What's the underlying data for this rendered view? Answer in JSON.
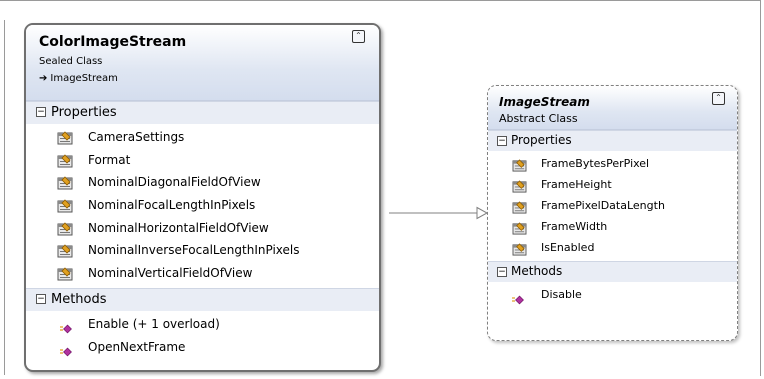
{
  "color_image_stream": {
    "title": "ColorImageStream",
    "kind": "Sealed Class",
    "base_arrow": "➔",
    "base": "ImageStream",
    "collapse_glyph": "⌃",
    "properties_label": "Properties",
    "properties": [
      "CameraSettings",
      "Format",
      "NominalDiagonalFieldOfView",
      "NominalFocalLengthInPixels",
      "NominalHorizontalFieldOfView",
      "NominalInverseFocalLengthInPixels",
      "NominalVerticalFieldOfView"
    ],
    "methods_label": "Methods",
    "methods": [
      "Enable (+ 1 overload)",
      "OpenNextFrame"
    ]
  },
  "image_stream": {
    "title": "ImageStream",
    "kind": "Abstract Class",
    "collapse_glyph": "⌃",
    "properties_label": "Properties",
    "properties": [
      "FrameBytesPerPixel",
      "FrameHeight",
      "FramePixelDataLength",
      "FrameWidth",
      "IsEnabled"
    ],
    "methods_label": "Methods",
    "methods": [
      "Disable"
    ]
  },
  "section_toggle_glyph": "−",
  "colors": {
    "header_gradient_end": "#d4ddee",
    "section_bg": "#e9edf5",
    "method_icon": "#b0329e"
  }
}
